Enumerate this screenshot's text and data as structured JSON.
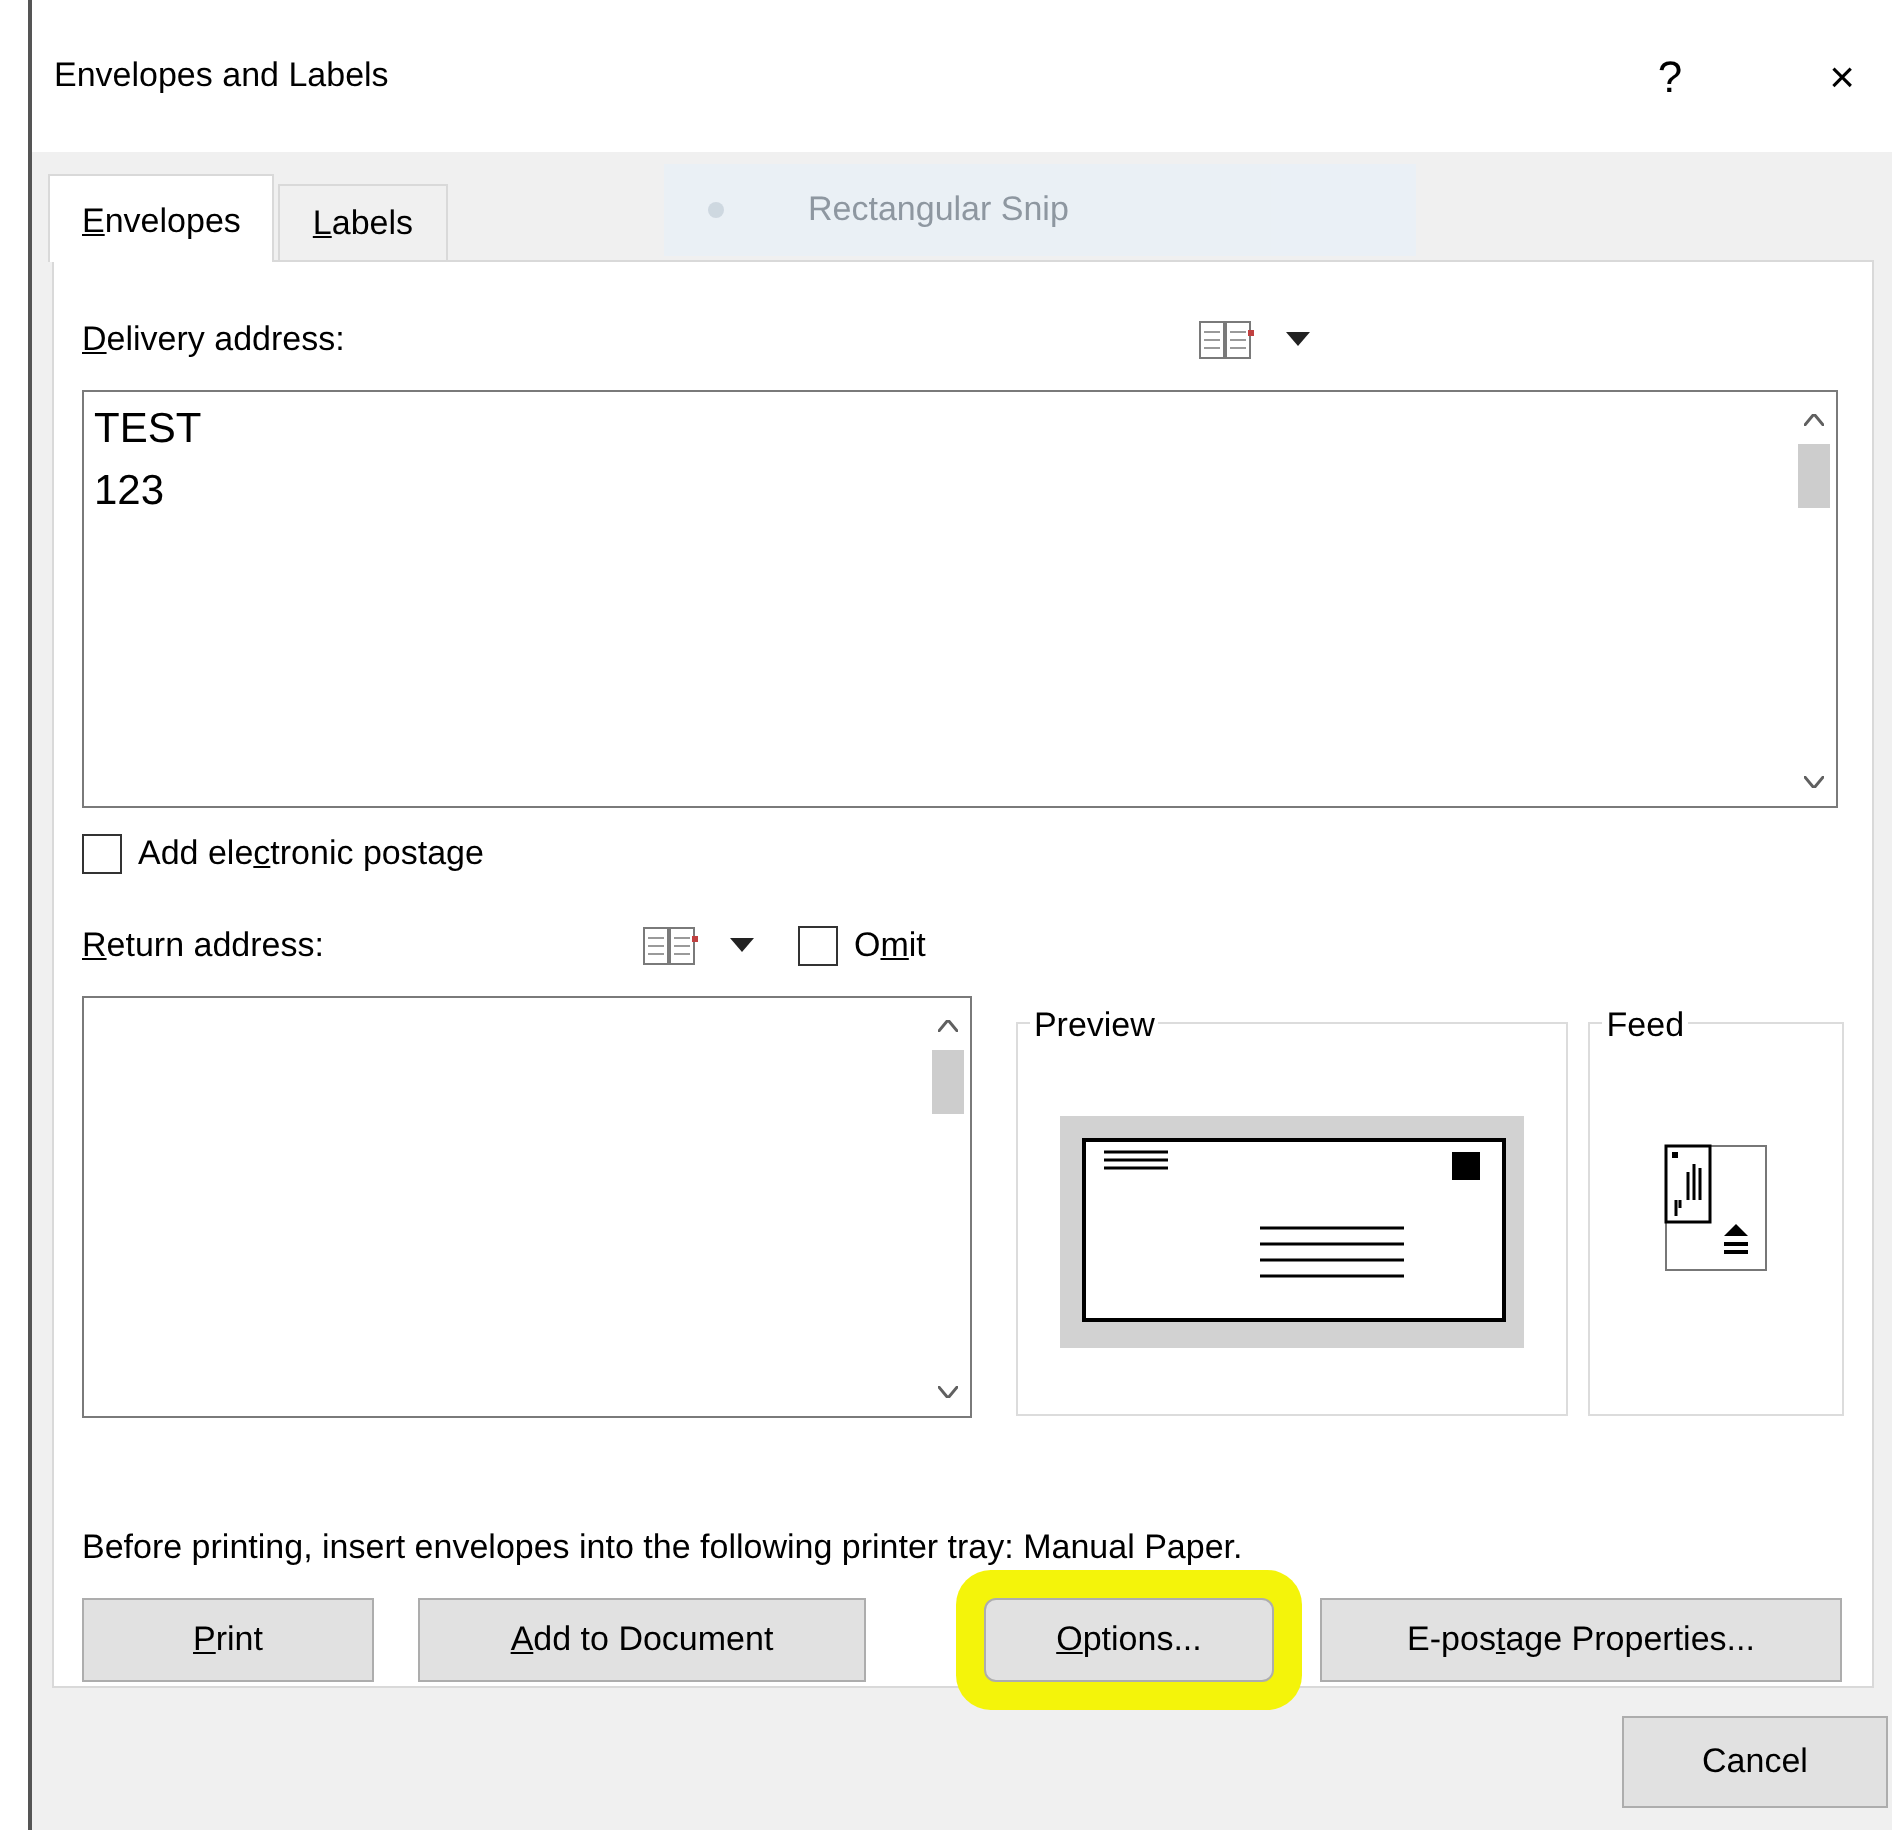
{
  "window": {
    "title": "Envelopes and Labels",
    "help": "?",
    "close": "×"
  },
  "tabs": [
    {
      "label": {
        "key": "E",
        "post": "nvelopes"
      },
      "selected": true
    },
    {
      "label": {
        "key": "L",
        "post": "abels"
      },
      "selected": false
    }
  ],
  "snip_overlay": {
    "label": "Rectangular Snip"
  },
  "delivery": {
    "label": {
      "key": "D",
      "post": "elivery address:"
    },
    "value": "TEST\n123"
  },
  "postage": {
    "label": {
      "pre": "Add ele",
      "key": "c",
      "post": "tronic postage"
    },
    "checked": false
  },
  "return": {
    "label": {
      "key": "R",
      "post": "eturn address:"
    },
    "omit": {
      "label": {
        "pre": "O",
        "key": "m",
        "post": "it"
      },
      "checked": false
    }
  },
  "preview": {
    "title": "Preview"
  },
  "feed": {
    "title": "Feed"
  },
  "note": "Before printing, insert envelopes into the following printer tray: Manual Paper.",
  "buttons": [
    {
      "label": {
        "key": "P",
        "post": "rint"
      },
      "highlighted": false
    },
    {
      "label": {
        "key": "A",
        "post": "dd to Document"
      },
      "highlighted": false
    },
    {
      "label": {
        "key": "O",
        "post": "ptions..."
      },
      "highlighted": true
    },
    {
      "label": {
        "pre": "E-pos",
        "key": "t",
        "post": "age Properties..."
      },
      "highlighted": false
    }
  ],
  "cancel": "Cancel"
}
